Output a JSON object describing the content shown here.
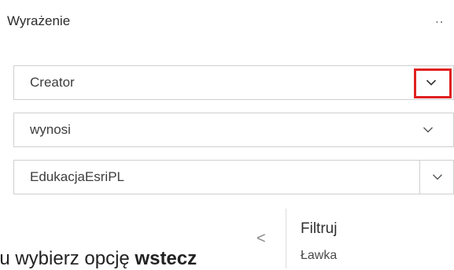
{
  "header": {
    "title": "Wyrażenie",
    "more_label": ".."
  },
  "fields": [
    {
      "value": "Creator",
      "icon": "chevron-down-icon"
    },
    {
      "value": "wynosi",
      "icon": "chevron-down-icon"
    },
    {
      "value": "EdukacjaEsriPL",
      "icon": "chevron-down-icon"
    }
  ],
  "highlight_color": "#e02020",
  "side_panel": {
    "back_label": "<",
    "title": "Filtruj",
    "subtitle": "Ławka"
  },
  "instruction": {
    "prefix": "lu wybierz opcję ",
    "bold": "wstecz"
  }
}
